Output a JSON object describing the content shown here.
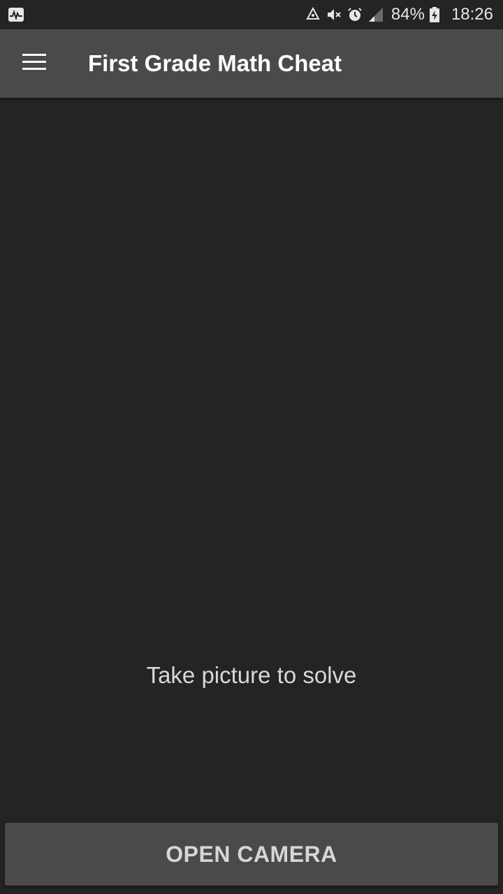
{
  "status_bar": {
    "left_icon": "activity-monitor-icon",
    "icons": [
      "recycle-icon",
      "mute-icon",
      "alarm-icon",
      "signal-icon",
      "battery-charging-icon"
    ],
    "battery_percent": "84%",
    "time": "18:26"
  },
  "app_bar": {
    "menu_icon": "hamburger-menu-icon",
    "title": "First Grade Math Cheat"
  },
  "main": {
    "hint": "Take picture to solve"
  },
  "action": {
    "camera_label": "OPEN CAMERA"
  },
  "colors": {
    "background": "#242424",
    "app_bar": "#4a4a4a",
    "button": "#4a4a4a",
    "title_text": "#ffffff",
    "hint_text": "#d8d8d8"
  }
}
